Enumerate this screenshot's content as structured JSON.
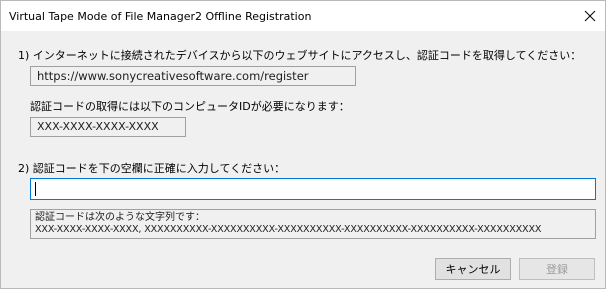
{
  "window": {
    "title": "Virtual Tape Mode of File Manager2 Offline Registration",
    "close_icon": "close-icon"
  },
  "step1": {
    "label": "1) インターネットに接続されたデバイスから以下のウェブサイトにアクセスし、認証コードを取得してください：",
    "url": "https://www.sonycreativesoftware.com/register",
    "id_note": "認証コードの取得には以下のコンピュータIDが必要になります：",
    "computer_id": "XXX-XXXX-XXXX-XXXX"
  },
  "step2": {
    "label": "2) 認証コードを下の空欄に正確に入力してください：",
    "code_value": "",
    "format_label": "認証コードは次のような文字列です：",
    "format_example": "XXX-XXXX-XXXX-XXXX, XXXXXXXXXX-XXXXXXXXXX-XXXXXXXXXX-XXXXXXXXXX-XXXXXXXXXX-XXXXXXXXXX"
  },
  "buttons": {
    "cancel": "キャンセル",
    "register": "登録"
  },
  "colors": {
    "focus_border": "#0078d7",
    "disabled_text": "#9c9c9c",
    "dialog_bg": "#f0f0f0"
  }
}
